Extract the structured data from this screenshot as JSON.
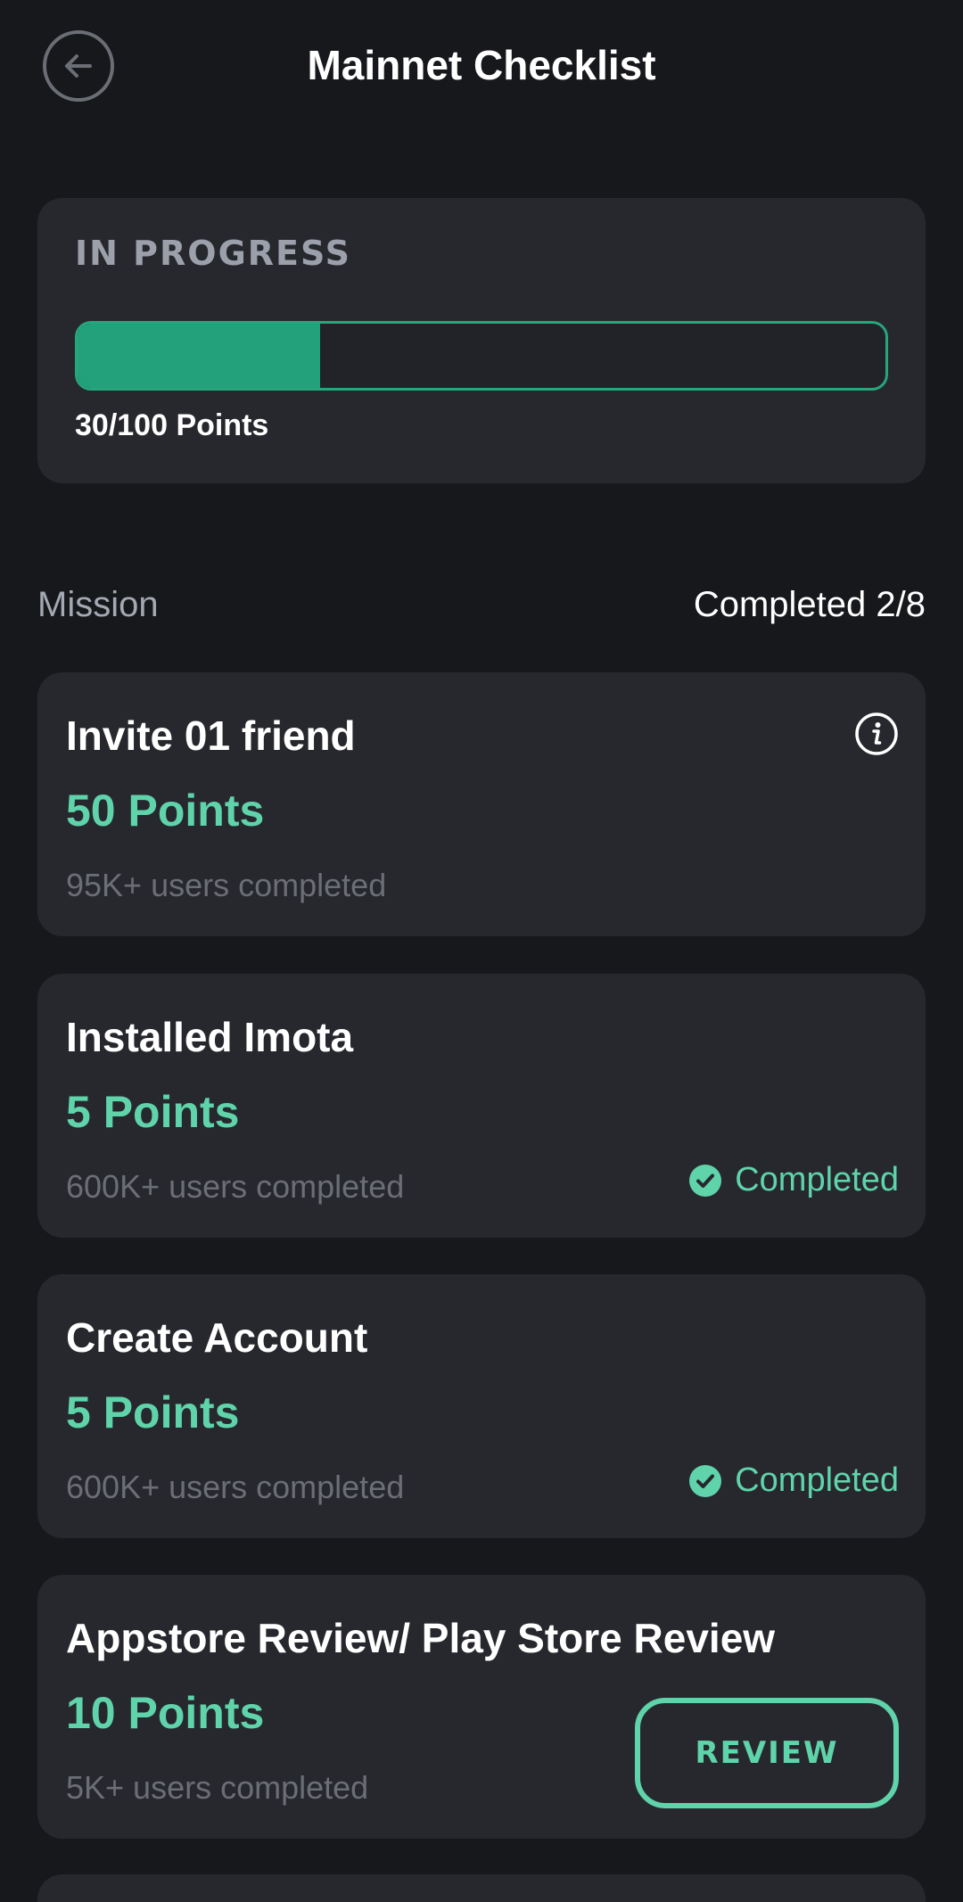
{
  "header": {
    "title": "Mainnet Checklist",
    "back_icon": "arrow-left-circle-icon"
  },
  "progress": {
    "status": "IN PROGRESS",
    "points_text": "30/100 Points",
    "fraction": 0.3
  },
  "missions": {
    "label": "Mission",
    "completed_count": "Completed 2/8",
    "items": [
      {
        "name": "Invite 01 friend",
        "points": "50 Points",
        "users": "95K+ users completed",
        "icon": "info-icon"
      },
      {
        "name": "Installed Imota",
        "points": "5 Points",
        "users": "600K+ users completed",
        "status": "Completed",
        "status_icon": "check-circle-icon"
      },
      {
        "name": "Create Account",
        "points": "5 Points",
        "users": "600K+ users completed",
        "status": "Completed",
        "status_icon": "check-circle-icon"
      },
      {
        "name": "Appstore Review/ Play Store Review",
        "points": "10 Points",
        "users": "5K+ users completed",
        "button": "REVIEW"
      }
    ]
  },
  "colors": {
    "background": "#17181c",
    "card": "#27282d",
    "accent": "#5fd3aa",
    "progress_fill": "#23a17a",
    "muted_text": "#6b6e75"
  }
}
